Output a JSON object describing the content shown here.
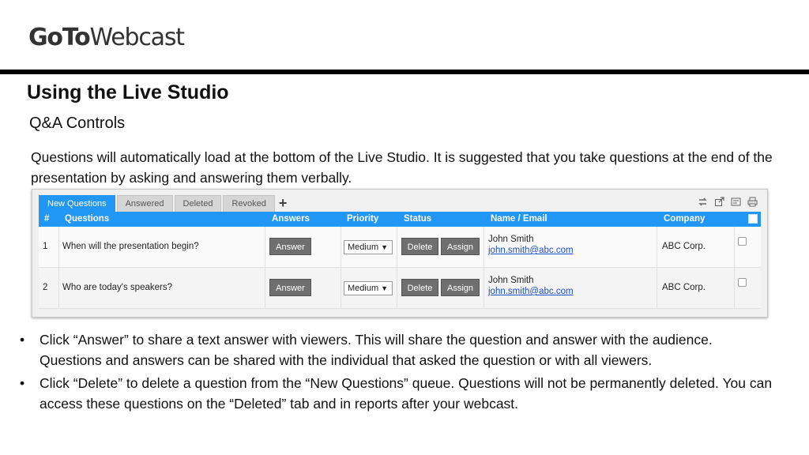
{
  "brand": {
    "logo_bold": "GoTo",
    "logo_light": "Webcast"
  },
  "slide": {
    "title": "Using the Live Studio",
    "subtitle": "Q&A Controls",
    "intro": "Questions will automatically load at the bottom of the Live Studio. It is suggested that you take questions at the end of the presentation by asking and answering them verbally."
  },
  "studio": {
    "tabs": [
      {
        "label": "New Questions",
        "active": true
      },
      {
        "label": "Answered"
      },
      {
        "label": "Deleted"
      },
      {
        "label": "Revoked"
      }
    ],
    "add_tab": "+",
    "tool_icons": [
      "swap-icon",
      "popout-icon",
      "export-icon",
      "print-icon"
    ],
    "columns": {
      "num": "#",
      "question": "Questions",
      "answers": "Answers",
      "priority": "Priority",
      "status": "Status",
      "name": "Name / Email",
      "company": "Company"
    },
    "rows": [
      {
        "num": "1",
        "question": "When will the presentation begin?",
        "answer_label": "Answer",
        "priority": "Medium",
        "delete_label": "Delete",
        "assign_label": "Assign",
        "name": "John Smith",
        "email": "john.smith@abc.com",
        "company": "ABC Corp."
      },
      {
        "num": "2",
        "question": "Who are today's speakers?",
        "answer_label": "Answer",
        "priority": "Medium",
        "delete_label": "Delete",
        "assign_label": "Assign",
        "name": "John Smith",
        "email": "john.smith@abc.com",
        "company": "ABC Corp."
      }
    ],
    "colors": {
      "accent": "#2196f3",
      "button": "#6f6f6f",
      "link": "#1a4fc8"
    }
  },
  "bullets": [
    "Click “Answer” to share a text answer with viewers.  This will share the question and answer with the audience.  Questions and answers can be shared with the individual that asked the question or with all viewers.",
    "Click “Delete” to delete a question from the “New Questions” queue.  Questions will not be permanently deleted.  You can access these questions on the “Deleted” tab and in reports after your webcast."
  ],
  "bullet_char": "•"
}
